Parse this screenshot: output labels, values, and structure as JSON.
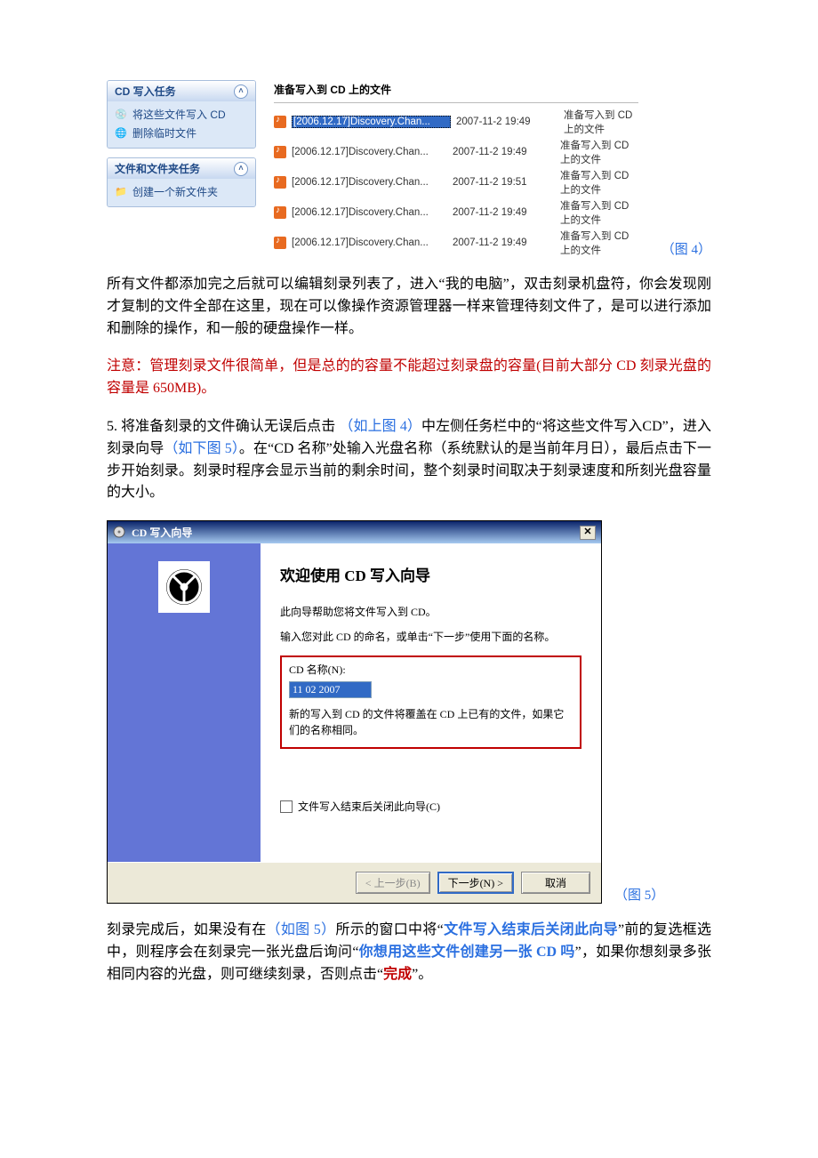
{
  "fig4": {
    "label": "（图 4）",
    "tasks": {
      "cd": {
        "title": "CD 写入任务",
        "items": [
          "将这些文件写入 CD",
          "删除临时文件"
        ]
      },
      "folder": {
        "title": "文件和文件夹任务",
        "items": [
          "创建一个新文件夹"
        ]
      }
    },
    "list_header": "准备写入到 CD 上的文件",
    "files": [
      {
        "name": "[2006.12.17]Discovery.Chan...",
        "date": "2007-11-2 19:49",
        "status": "准备写入到 CD 上的文件",
        "selected": true
      },
      {
        "name": "[2006.12.17]Discovery.Chan...",
        "date": "2007-11-2 19:49",
        "status": "准备写入到 CD 上的文件",
        "selected": false
      },
      {
        "name": "[2006.12.17]Discovery.Chan...",
        "date": "2007-11-2 19:51",
        "status": "准备写入到 CD 上的文件",
        "selected": false
      },
      {
        "name": "[2006.12.17]Discovery.Chan...",
        "date": "2007-11-2 19:49",
        "status": "准备写入到 CD 上的文件",
        "selected": false
      },
      {
        "name": "[2006.12.17]Discovery.Chan...",
        "date": "2007-11-2 19:49",
        "status": "准备写入到 CD 上的文件",
        "selected": false
      }
    ]
  },
  "para1": "所有文件都添加完之后就可以编辑刻录列表了，进入“我的电脑”，双击刻录机盘符，你会发现刚才复制的文件全部在这里，现在可以像操作资源管理器一样来管理待刻文件了，是可以进行添加和删除的操作，和一般的硬盘操作一样。",
  "para2": "注意：管理刻录文件很简单，但是总的的容量不能超过刻录盘的容量(目前大部分 CD 刻录光盘的容量是 650MB)。",
  "step5": {
    "num": "5.",
    "a": "  将准备刻录的文件确认无误后点击 ",
    "link1": "（如上图 4）",
    "b": "中左侧任务栏中的“将这些文件写入CD”，进入刻录向导",
    "link2": "（如下图 5）",
    "c": "。在“CD 名称”处输入光盘名称（系统默认的是当前年月日），最后点击下一步开始刻录。刻录时程序会显示当前的剩余时间，整个刻录时间取决于刻录速度和所刻光盘容量的大小。"
  },
  "wizard": {
    "title": "CD 写入向导",
    "heading": "欢迎使用 CD 写入向导",
    "intro": "此向导帮助您将文件写入到 CD。",
    "prompt": "输入您对此 CD 的命名，或单击“下一步”使用下面的名称。",
    "name_label": "CD 名称(N):",
    "name_value": "11 02 2007",
    "overwrite_note": "新的写入到 CD 的文件将覆盖在 CD 上已有的文件，如果它们的名称相同。",
    "close_chk": "文件写入结束后关闭此向导(C)",
    "btn_back": "< 上一步(B)",
    "btn_next": "下一步(N) >",
    "btn_cancel": "取消",
    "label": "（图 5）"
  },
  "para3": {
    "a": "刻录完成后，如果没有在",
    "link": "（如图 5）",
    "b": "所示的窗口中将“",
    "strong1": "文件写入结束后关闭此向导",
    "c": "”前的复选框选中，则程序会在刻录完一张光盘后询问“",
    "strong2": "你想用这些文件创建另一张 CD 吗",
    "d": "”，如果你想刻录多张相同内容的光盘，则可继续刻录，否则点击“",
    "strong3": "完成",
    "e": "”。"
  }
}
